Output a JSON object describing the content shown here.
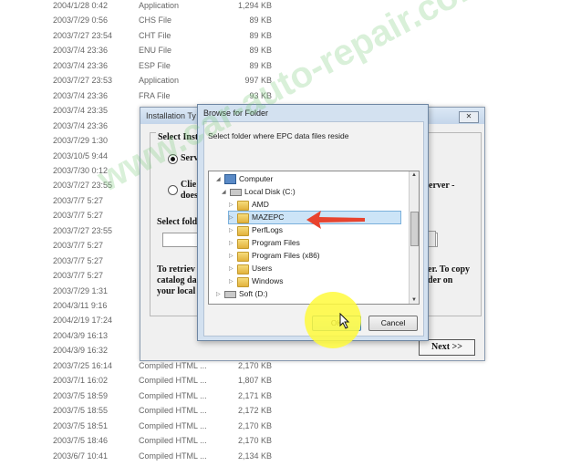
{
  "file_list": [
    {
      "date": "2004/1/28 0:42",
      "type": "Application",
      "size": "1,294 KB"
    },
    {
      "date": "2003/7/29 0:56",
      "type": "CHS File",
      "size": "89 KB"
    },
    {
      "date": "2003/7/27 23:54",
      "type": "CHT File",
      "size": "89 KB"
    },
    {
      "date": "2003/7/4 23:36",
      "type": "ENU File",
      "size": "89 KB"
    },
    {
      "date": "2003/7/4 23:36",
      "type": "ESP File",
      "size": "89 KB"
    },
    {
      "date": "2003/7/27 23:53",
      "type": "Application",
      "size": "997 KB"
    },
    {
      "date": "2003/7/4 23:36",
      "type": "FRA File",
      "size": "93 KB"
    },
    {
      "date": "2003/7/4 23:35",
      "type": "",
      "size": ""
    },
    {
      "date": "2003/7/4 23:36",
      "type": "",
      "size": ""
    },
    {
      "date": "2003/7/29 1:30",
      "type": "",
      "size": ""
    },
    {
      "date": "2003/10/5 9:44",
      "type": "",
      "size": ""
    },
    {
      "date": "2003/7/30 0:12",
      "type": "",
      "size": ""
    },
    {
      "date": "2003/7/27 23:55",
      "type": "",
      "size": ""
    },
    {
      "date": "2003/7/7 5:27",
      "type": "",
      "size": ""
    },
    {
      "date": "2003/7/7 5:27",
      "type": "",
      "size": ""
    },
    {
      "date": "2003/7/27 23:55",
      "type": "",
      "size": ""
    },
    {
      "date": "2003/7/7 5:27",
      "type": "",
      "size": ""
    },
    {
      "date": "2003/7/7 5:27",
      "type": "",
      "size": ""
    },
    {
      "date": "2003/7/7 5:27",
      "type": "",
      "size": ""
    },
    {
      "date": "2003/7/29 1:31",
      "type": "",
      "size": ""
    },
    {
      "date": "2004/3/11 9:16",
      "type": "",
      "size": ""
    },
    {
      "date": "2004/2/19 17:24",
      "type": "",
      "size": ""
    },
    {
      "date": "2004/3/9 16:13",
      "type": "",
      "size": ""
    },
    {
      "date": "2004/3/9 16:32",
      "type": "",
      "size": ""
    },
    {
      "date": "2003/7/25 16:14",
      "type": "Compiled HTML ...",
      "size": "2,170 KB"
    },
    {
      "date": "2003/7/1 16:02",
      "type": "Compiled HTML ...",
      "size": "1,807 KB"
    },
    {
      "date": "2003/7/5 18:59",
      "type": "Compiled HTML ...",
      "size": "2,171 KB"
    },
    {
      "date": "2003/7/5 18:55",
      "type": "Compiled HTML ...",
      "size": "2,172 KB"
    },
    {
      "date": "2003/7/5 18:51",
      "type": "Compiled HTML ...",
      "size": "2,170 KB"
    },
    {
      "date": "2003/7/5 18:46",
      "type": "Compiled HTML ...",
      "size": "2,170 KB"
    },
    {
      "date": "2003/6/7 10:41",
      "type": "Compiled HTML ...",
      "size": "2,134 KB"
    }
  ],
  "install_dialog": {
    "title": "Installation Ty",
    "close": "✕",
    "group_label": "Select Inst",
    "server_option": "Serv",
    "client_option_line1": "Clie",
    "client_option_line2": "does",
    "server_right": "erver -",
    "folder_label": "Select fold",
    "retrieve_text_line1": "To retriev",
    "retrieve_text_line2": "catalog da",
    "retrieve_text_line3": "your local",
    "copy_text_line1": "er. To copy",
    "copy_text_line2": "der on",
    "next_label": "Next >>"
  },
  "browse_dialog": {
    "title": "Browse for Folder",
    "instruction": "Select folder where EPC data files reside",
    "tree": [
      {
        "label": "Computer",
        "icon": "computer-icon",
        "expander": "◢"
      },
      {
        "label": "Local Disk (C:)",
        "icon": "disk-icon",
        "expander": "◢"
      },
      {
        "label": "AMD",
        "icon": "folder-icon",
        "expander": "▷"
      },
      {
        "label": "MAZEPC",
        "icon": "folder-icon",
        "expander": "▷"
      },
      {
        "label": "PerfLogs",
        "icon": "folder-icon",
        "expander": "▷"
      },
      {
        "label": "Program Files",
        "icon": "folder-icon",
        "expander": "▷"
      },
      {
        "label": "Program Files (x86)",
        "icon": "folder-icon",
        "expander": "▷"
      },
      {
        "label": "Users",
        "icon": "folder-icon",
        "expander": "▷"
      },
      {
        "label": "Windows",
        "icon": "folder-icon",
        "expander": "▷"
      },
      {
        "label": "Soft (D:)",
        "icon": "disk-icon",
        "expander": "▷"
      }
    ],
    "ok_label": "OK",
    "cancel_label": "Cancel"
  },
  "watermark": "www.car-auto-repair.com",
  "colors": {
    "highlight": "#fff23c",
    "arrow": "#e8432e",
    "selection": "#cce4f7"
  }
}
